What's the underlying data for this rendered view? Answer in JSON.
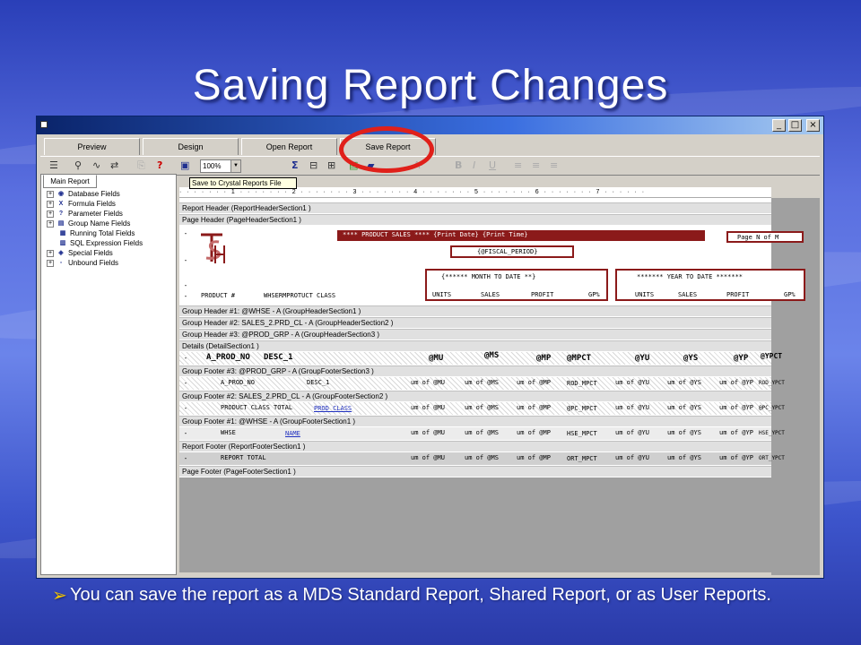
{
  "slide": {
    "title": "Saving Report Changes",
    "bullet": "You can save the report as a MDS Standard Report, Shared Report, or as User Reports.",
    "bullet_glyph": "➢"
  },
  "window": {
    "tabs": [
      "Preview",
      "Design",
      "Open Report",
      "Save Report"
    ],
    "zoom": "100%",
    "tooltip": "Save to Crystal Reports File",
    "tree_tab": "Main Report",
    "tree_items": [
      {
        "label": "Database Fields",
        "icon": "database-icon"
      },
      {
        "label": "Formula Fields",
        "icon": "formula-icon"
      },
      {
        "label": "Parameter Fields",
        "icon": "parameter-icon"
      },
      {
        "label": "Group Name Fields",
        "icon": "group-icon"
      },
      {
        "label": "Running Total Fields",
        "icon": "running-total-icon"
      },
      {
        "label": "SQL Expression Fields",
        "icon": "sql-icon"
      },
      {
        "label": "Special Fields",
        "icon": "special-icon"
      },
      {
        "label": "Unbound Fields",
        "icon": "unbound-icon"
      }
    ],
    "ruler_text": "· · · · · · · 1 · · · · · · · 2 · · · · · · · 3 · · · · · · · 4 · · · · · · · 5 · · · · · · · 6 · · · · · · · 7 · · · · · ·"
  },
  "report": {
    "sections": {
      "report_header": "Report Header  (ReportHeaderSection1 )",
      "page_header": "Page Header  (PageHeaderSection1 )",
      "gh1": "Group Header #1: @WHSE - A (GroupHeaderSection1 )",
      "gh2": "Group Header #2: SALES_2.PRD_CL - A (GroupHeaderSection2 )",
      "gh3": "Group Header #3: @PROD_GRP - A (GroupHeaderSection3 )",
      "details": "Details  (DetailSection1 )",
      "gf3": "Group Footer #3: @PROD_GRP - A (GroupFooterSection3 )",
      "gf2": "Group Footer #2: SALES_2.PRD_CL - A (GroupFooterSection2 )",
      "gf1": "Group Footer #1: @WHSE - A (GroupFooterSection1 )",
      "report_footer": "Report Footer  (ReportFooterSection1 )",
      "page_footer": "Page Footer  (PageFooterSection1 )"
    },
    "page_header": {
      "banner": "****  PRODUCT SALES  ****          {Print Date}  {Print Time}",
      "page_box": "Page N of M",
      "fiscal": "{@FISCAL_PERIOD}",
      "mtd": "{****** MONTH TO DATE **}",
      "ytd": "******* YEAR TO DATE *******",
      "product": "PRODUCT #",
      "desc": "WHSERMPROTUCT CLASS",
      "units": "UNITS",
      "sales": "SALES",
      "profit": "PROFIT",
      "gp": "GP%",
      "units2": "UNITS",
      "sales2": "SALES",
      "profit2": "PROFIT",
      "gp2": "GP%"
    },
    "details": {
      "prod_no": "A_PROD_NO",
      "desc": "DESC_1",
      "mu": "@MU",
      "ms": "@MS",
      "mp": "@MP",
      "mpct": "@MPCT",
      "yu": "@YU",
      "ys": "@YS",
      "yp": "@YP",
      "ypct": "@YPCT"
    },
    "gf3_row": {
      "c1": "A_PROD_NO",
      "c2": "DESC_1",
      "c3": "um of @MU",
      "c4": "um of @MS",
      "c5": "um of @MP",
      "c6": "ROD_MPCT",
      "c7": "um of @YU",
      "c8": "um of @YS",
      "c9": "um of @YP",
      "c10": "ROD_YPCT"
    },
    "gf2_row": {
      "c1": "PRODUCT CLASS TOTAL",
      "c2": "PROD CLASS",
      "c3": "um of @MU",
      "c4": "um of @MS",
      "c5": "um of @MP",
      "c6": "@PC_MPCT",
      "c7": "um of @YU",
      "c8": "um of @YS",
      "c9": "um of @YP",
      "c10": "@PC_YPCT"
    },
    "gf1_row": {
      "c1": "WHSE",
      "c2": "NAME",
      "c3": "um of @MU",
      "c4": "um of @MS",
      "c5": "um of @MP",
      "c6": "HSE_MPCT",
      "c7": "um of @YU",
      "c8": "um of @YS",
      "c9": "um of @YP",
      "c10": "HSE_YPCT"
    },
    "rf_row": {
      "c1": "REPORT TOTAL",
      "c3": "um of @MU",
      "c4": "um of @MS",
      "c5": "um of @MP",
      "c6": "ORT_MPCT",
      "c7": "um of @YU",
      "c8": "um of @YS",
      "c9": "um of @YP",
      "c10": "ORT_YPCT"
    },
    "colors": {
      "maroon": "#8b1a1a",
      "highlight": "#e0201a"
    }
  }
}
